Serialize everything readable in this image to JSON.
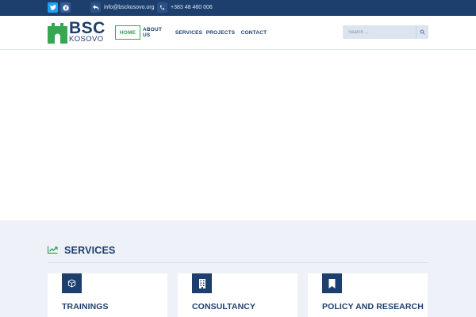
{
  "topbar": {
    "email": "info@bsckosovo.org",
    "phone": "+383 48 460 006",
    "icons": [
      "twitter-icon",
      "facebook-icon",
      "reply-icon",
      "phone-icon"
    ]
  },
  "logo": {
    "title": "BSC",
    "subtitle": "KOSOVO"
  },
  "nav": {
    "home": "HOME",
    "about": "ABOUT US",
    "services": "SERVICES",
    "projects": "PROJECTS",
    "contact": "CONTACT",
    "active": "HOME"
  },
  "search": {
    "placeholder": "Search ...",
    "value": ""
  },
  "services": {
    "title": "SERVICES",
    "cards": [
      {
        "title": "TRAININGS",
        "icon": "cube-icon"
      },
      {
        "title": "CONSULTANCY",
        "icon": "building-icon"
      },
      {
        "title": "POLICY AND RESEARCH",
        "icon": "bookmark-icon"
      }
    ]
  },
  "colors": {
    "primary": "#1c3f6e",
    "accent": "#34a853",
    "background_section": "#eef1f7"
  }
}
